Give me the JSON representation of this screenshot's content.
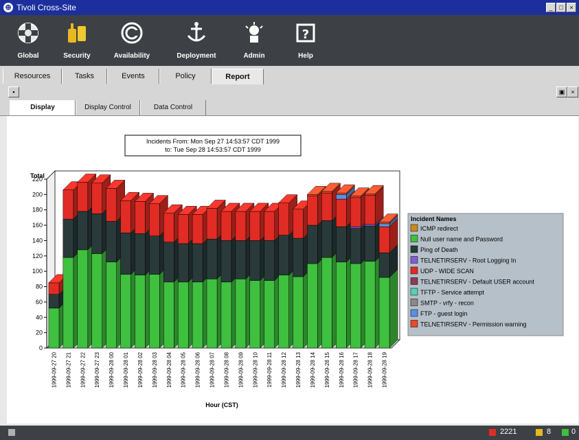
{
  "window": {
    "title": "Tivoli Cross-Site",
    "buttons": [
      "_",
      "□",
      "×"
    ]
  },
  "toolbar": [
    {
      "label": "Global",
      "icon": "globe-icon"
    },
    {
      "label": "Security",
      "icon": "lock-icon"
    },
    {
      "label": "Availability",
      "icon": "availability-icon"
    },
    {
      "label": "Deployment",
      "icon": "deployment-icon"
    },
    {
      "label": "Admin",
      "icon": "admin-icon"
    },
    {
      "label": "Help",
      "icon": "help-icon"
    }
  ],
  "nav_tabs": [
    {
      "label": "Resources",
      "active": false
    },
    {
      "label": "Tasks",
      "active": false
    },
    {
      "label": "Events",
      "active": false
    },
    {
      "label": "Policy",
      "active": false
    },
    {
      "label": "Report",
      "active": true
    }
  ],
  "sub_tabs": [
    {
      "label": "Display",
      "active": true
    },
    {
      "label": "Display Control",
      "active": false
    },
    {
      "label": "Data Control",
      "active": false
    }
  ],
  "status": {
    "count_red": "2221",
    "count_yellow": "8",
    "count_green": "0"
  },
  "chart_data": {
    "type": "bar",
    "stacked": true,
    "title_line1": "Incidents From: Mon Sep 27 14:53:57 CDT 1999",
    "title_line2": "to: Tue Sep 28 14:53:57 CDT 1999",
    "ylabel": "Total",
    "xlabel": "Hour (CST)",
    "ylim": [
      0,
      220
    ],
    "yticks": [
      0,
      20,
      40,
      60,
      80,
      100,
      120,
      140,
      160,
      180,
      200,
      220
    ],
    "legend_title": "Incident Names",
    "legend_position": "right",
    "categories": [
      "1999-09-27 20",
      "1999-09-27 21",
      "1999-09-27 22",
      "1999-09-27 23",
      "1999-09-28 00",
      "1999-09-28 01",
      "1999-09-28 02",
      "1999-09-28 03",
      "1999-09-28 04",
      "1999-09-28 05",
      "1999-09-28 06",
      "1999-09-28 07",
      "1999-09-28 08",
      "1999-09-28 09",
      "1999-09-28 10",
      "1999-09-28 11",
      "1999-09-28 12",
      "1999-09-28 13",
      "1999-09-28 14",
      "1999-09-28 15",
      "1999-09-28 16",
      "1999-09-28 17",
      "1999-09-28 18",
      "1999-09-28 19"
    ],
    "series": [
      {
        "name": "ICMP redirect",
        "color": "#c98a1c",
        "values": [
          0,
          0,
          0,
          0,
          0,
          0,
          0,
          0,
          0,
          0,
          0,
          0,
          0,
          0,
          0,
          0,
          0,
          0,
          0,
          0,
          0,
          0,
          0,
          0
        ]
      },
      {
        "name": "Null user name and Password",
        "color": "#3fc03f",
        "values": [
          52,
          118,
          128,
          123,
          112,
          96,
          95,
          96,
          86,
          86,
          86,
          90,
          86,
          90,
          88,
          88,
          95,
          93,
          110,
          118,
          112,
          110,
          113,
          92
        ]
      },
      {
        "name": "Ping of Death",
        "color": "#2a3a3a",
        "values": [
          18,
          50,
          50,
          52,
          53,
          54,
          54,
          50,
          52,
          50,
          50,
          52,
          54,
          50,
          52,
          52,
          52,
          50,
          50,
          48,
          46,
          46,
          46,
          32
        ]
      },
      {
        "name": "TELNETIRSERV - Root Logging In",
        "color": "#7f5fd0",
        "values": [
          0,
          0,
          0,
          0,
          0,
          0,
          0,
          0,
          0,
          0,
          0,
          0,
          0,
          0,
          0,
          0,
          0,
          0,
          0,
          0,
          0,
          2,
          2,
          0
        ]
      },
      {
        "name": "UDP - WIDE SCAN",
        "color": "#e02c24",
        "values": [
          15,
          38,
          38,
          40,
          43,
          42,
          42,
          42,
          38,
          38,
          38,
          40,
          38,
          38,
          38,
          38,
          42,
          38,
          38,
          36,
          36,
          38,
          38,
          34
        ]
      },
      {
        "name": "TELNETIRSERV - Default USER account",
        "color": "#8a3a5a",
        "values": [
          0,
          0,
          0,
          0,
          0,
          0,
          0,
          0,
          0,
          0,
          0,
          0,
          0,
          0,
          0,
          0,
          0,
          0,
          0,
          0,
          0,
          0,
          0,
          0
        ]
      },
      {
        "name": "TFTP - Service attempt",
        "color": "#5ad0b0",
        "values": [
          0,
          0,
          0,
          0,
          0,
          0,
          0,
          0,
          0,
          0,
          0,
          0,
          0,
          0,
          0,
          0,
          0,
          0,
          0,
          0,
          0,
          0,
          0,
          0
        ]
      },
      {
        "name": "SMTP - vrfy - recon",
        "color": "#8a8a8a",
        "values": [
          0,
          0,
          0,
          0,
          0,
          0,
          0,
          0,
          0,
          0,
          0,
          0,
          0,
          0,
          0,
          0,
          0,
          0,
          0,
          0,
          0,
          0,
          0,
          0
        ]
      },
      {
        "name": "FTP - guest login",
        "color": "#5a90e0",
        "values": [
          0,
          0,
          0,
          0,
          0,
          0,
          0,
          0,
          0,
          0,
          0,
          0,
          0,
          0,
          0,
          0,
          0,
          0,
          0,
          0,
          6,
          0,
          0,
          4
        ]
      },
      {
        "name": "TELNETIRSERV - Permission warning",
        "color": "#e84a2a",
        "values": [
          0,
          0,
          0,
          0,
          0,
          0,
          0,
          0,
          0,
          0,
          0,
          0,
          0,
          0,
          0,
          0,
          0,
          0,
          2,
          2,
          2,
          2,
          2,
          2
        ]
      }
    ]
  }
}
